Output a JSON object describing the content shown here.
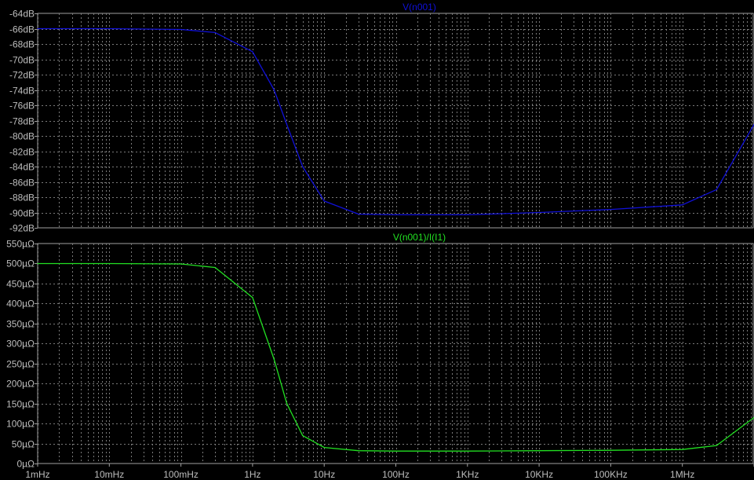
{
  "colors": {
    "background": "#000000",
    "grid": "#7a7a7a",
    "axis": "#a0a0a0",
    "tick_text": "#bdbdbd",
    "trace_top": "#1010d8",
    "trace_bottom": "#22e022"
  },
  "chart_data": [
    {
      "type": "line",
      "title": "V(n001)",
      "x_scale": "log",
      "x_unit": "Hz",
      "xlim": [
        0.001,
        10000000
      ],
      "y_unit": "dB",
      "ylim": [
        -92,
        -64
      ],
      "y_ticks": [
        "-64dB",
        "-66dB",
        "-68dB",
        "-70dB",
        "-72dB",
        "-74dB",
        "-76dB",
        "-78dB",
        "-80dB",
        "-82dB",
        "-84dB",
        "-86dB",
        "-88dB",
        "-90dB",
        "-92dB"
      ],
      "grid": true,
      "series": [
        {
          "name": "V(n001)",
          "x": [
            0.001,
            0.01,
            0.1,
            0.3,
            1,
            2,
            3,
            5,
            10,
            30,
            100,
            1000,
            10000,
            100000,
            1000000,
            3000000,
            10000000
          ],
          "y": [
            -66.0,
            -66.0,
            -66.1,
            -66.5,
            -69.0,
            -74.0,
            -78.5,
            -84.0,
            -88.5,
            -90.2,
            -90.3,
            -90.3,
            -90.0,
            -89.6,
            -89.0,
            -87.0,
            -78.5
          ]
        }
      ]
    },
    {
      "type": "line",
      "title": "V(n001)/I(I1)",
      "x_scale": "log",
      "x_unit": "Hz",
      "xlim": [
        0.001,
        10000000
      ],
      "y_unit": "µΩ",
      "ylim": [
        0,
        550
      ],
      "y_ticks": [
        "550µΩ",
        "500µΩ",
        "450µΩ",
        "400µΩ",
        "350µΩ",
        "300µΩ",
        "250µΩ",
        "200µΩ",
        "150µΩ",
        "100µΩ",
        "50µΩ",
        "0µΩ"
      ],
      "x_ticks": [
        "1mHz",
        "10mHz",
        "100mHz",
        "1Hz",
        "10Hz",
        "100Hz",
        "1KHz",
        "10KHz",
        "100KHz",
        "1MHz",
        "10MHz"
      ],
      "grid": true,
      "series": [
        {
          "name": "V(n001)/I(I1)",
          "x": [
            0.001,
            0.01,
            0.1,
            0.3,
            1,
            2,
            3,
            5,
            10,
            30,
            100,
            1000,
            10000,
            100000,
            1000000,
            3000000,
            10000000
          ],
          "y": [
            500,
            500,
            499,
            490,
            415,
            260,
            150,
            70,
            40,
            32,
            31,
            31,
            32,
            33,
            35,
            45,
            115
          ]
        }
      ]
    }
  ]
}
